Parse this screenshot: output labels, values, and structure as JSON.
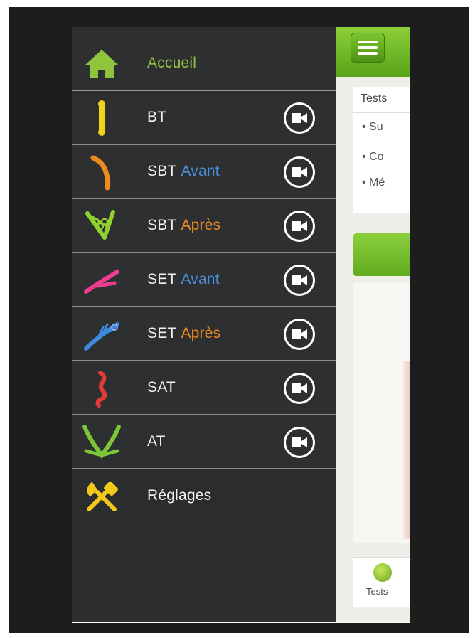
{
  "menu": {
    "items": [
      {
        "id": "accueil",
        "label": "Accueil",
        "qualifier": "",
        "icon": "home-icon",
        "video": false,
        "color": "#8fc43c"
      },
      {
        "id": "bt",
        "label": "BT",
        "qualifier": "",
        "icon": "bt-pin-icon",
        "video": true,
        "color": "#f2d21b"
      },
      {
        "id": "sbt-avant",
        "label": "SBT",
        "qualifier": "Avant",
        "icon": "sbt-avant-icon",
        "video": true,
        "color": "#f08a1f"
      },
      {
        "id": "sbt-apres",
        "label": "SBT",
        "qualifier": "Après",
        "icon": "sbt-apres-icon",
        "video": true,
        "color": "#8fd12e"
      },
      {
        "id": "set-avant",
        "label": "SET",
        "qualifier": "Avant",
        "icon": "set-avant-icon",
        "video": true,
        "color": "#ef3d8e"
      },
      {
        "id": "set-apres",
        "label": "SET",
        "qualifier": "Après",
        "icon": "set-apres-icon",
        "video": true,
        "color": "#3d8be0"
      },
      {
        "id": "sat",
        "label": "SAT",
        "qualifier": "",
        "icon": "sat-curve-icon",
        "video": true,
        "color": "#e23a3a"
      },
      {
        "id": "at",
        "label": "AT",
        "qualifier": "",
        "icon": "at-v-icon",
        "video": true,
        "color": "#7cc63a"
      },
      {
        "id": "reglages",
        "label": "Réglages",
        "qualifier": "",
        "icon": "tools-icon",
        "video": false,
        "color": "#f2c81b"
      }
    ]
  },
  "main": {
    "card_title": "Tests",
    "bullets": [
      "• Su",
      "• Co",
      "• Mé"
    ],
    "tab_label": "Tests"
  },
  "colors": {
    "accent_green": "#8fc43c",
    "avant_blue": "#4a8fd8",
    "apres_orange": "#ee8a1e"
  }
}
